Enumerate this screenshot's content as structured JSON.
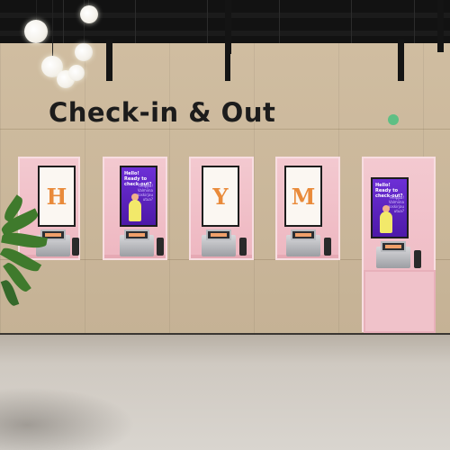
{
  "sign": {
    "text": "Check-in & Out"
  },
  "screens": [
    {
      "type": "letter",
      "letter": "H"
    },
    {
      "type": "welcome",
      "headline": "Hello!\nReady to\ncheck-out?",
      "secondary": "Heippa!\nValmiina\nuloskirjau\nutua?"
    },
    {
      "type": "letter",
      "letter": "Y"
    },
    {
      "type": "letter",
      "letter": "M"
    },
    {
      "type": "welcome",
      "headline": "Hello!\nReady to\ncheck-out?",
      "secondary": "Heippa!\nValmiina\nuloskirjau\nutua?"
    }
  ],
  "colors": {
    "wood": "#cdb99b",
    "niche_pink": "#f3c9d0",
    "letter_orange": "#e98a3a",
    "screen_purple": "#6d2fd6",
    "brand_dot": "#5fbf84",
    "ceiling": "#121212"
  }
}
